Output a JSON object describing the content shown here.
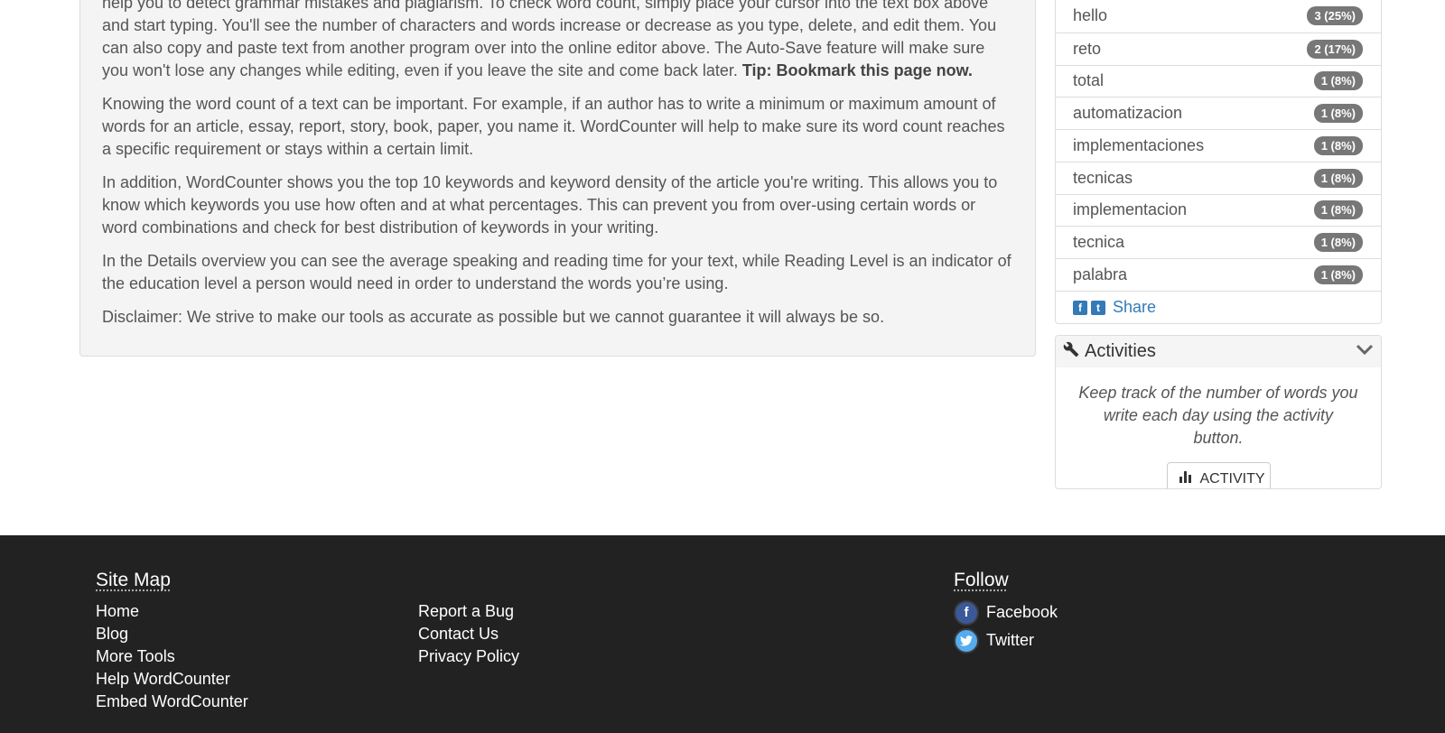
{
  "article": {
    "p1_line1": "help you to detect grammar mistakes and plagiarism. To check word count, simply place your cursor into the text box above and",
    "p1_rest": "start typing. You'll see the number of characters and words increase or decrease as you type, delete, and edit them. You can also copy and paste text from another program over into the online editor above. The Auto-Save feature will make sure you won't lose any changes while editing, even if you leave the site and come back later.",
    "p1_tip": "Tip: Bookmark this page now.",
    "p2": "Knowing the word count of a text can be important. For example, if an author has to write a minimum or maximum amount of words for an article, essay, report, story, book, paper, you name it. WordCounter will help to make sure its word count reaches a specific requirement or stays within a certain limit.",
    "p3": "In addition, WordCounter shows you the top 10 keywords and keyword density of the article you're writing. This allows you to know which keywords you use how often and at what percentages. This can prevent you from over-using certain words or word combinations and check for best distribution of keywords in your writing.",
    "p4": "In the Details overview you can see the average speaking and reading time for your text, while Reading Level is an indicator of the education level a person would need in order to understand the words you’re using.",
    "p5": "Disclaimer: We strive to make our tools as accurate as possible but we cannot guarantee it will always be so."
  },
  "keywords": [
    {
      "word": "hello",
      "badge": "3 (25%)"
    },
    {
      "word": "reto",
      "badge": "2 (17%)"
    },
    {
      "word": "total",
      "badge": "1 (8%)"
    },
    {
      "word": "automatizacion",
      "badge": "1 (8%)"
    },
    {
      "word": "implementaciones",
      "badge": "1 (8%)"
    },
    {
      "word": "tecnicas",
      "badge": "1 (8%)"
    },
    {
      "word": "implementacion",
      "badge": "1 (8%)"
    },
    {
      "word": "tecnica",
      "badge": "1 (8%)"
    },
    {
      "word": "palabra",
      "badge": "1 (8%)"
    }
  ],
  "share": {
    "label": "Share"
  },
  "activities": {
    "title": "Activities",
    "description": "Keep track of the number of words you write each day using the activity button.",
    "button_label": "ACTIVITY"
  },
  "footer": {
    "sitemap_heading": "Site Map",
    "sitemap_links": [
      "Home",
      "Blog",
      "More Tools",
      "Help WordCounter",
      "Embed WordCounter"
    ],
    "other_links": [
      "Report a Bug",
      "Contact Us",
      "Privacy Policy"
    ],
    "follow_heading": "Follow",
    "social": [
      {
        "label": "Facebook",
        "icon": "facebook-icon",
        "color": "#3b5998"
      },
      {
        "label": "Twitter",
        "icon": "twitter-icon",
        "color": "#55acee"
      }
    ]
  },
  "colors": {
    "link": "#337ab7",
    "badge": "#777777",
    "footer_bg": "#222222"
  }
}
